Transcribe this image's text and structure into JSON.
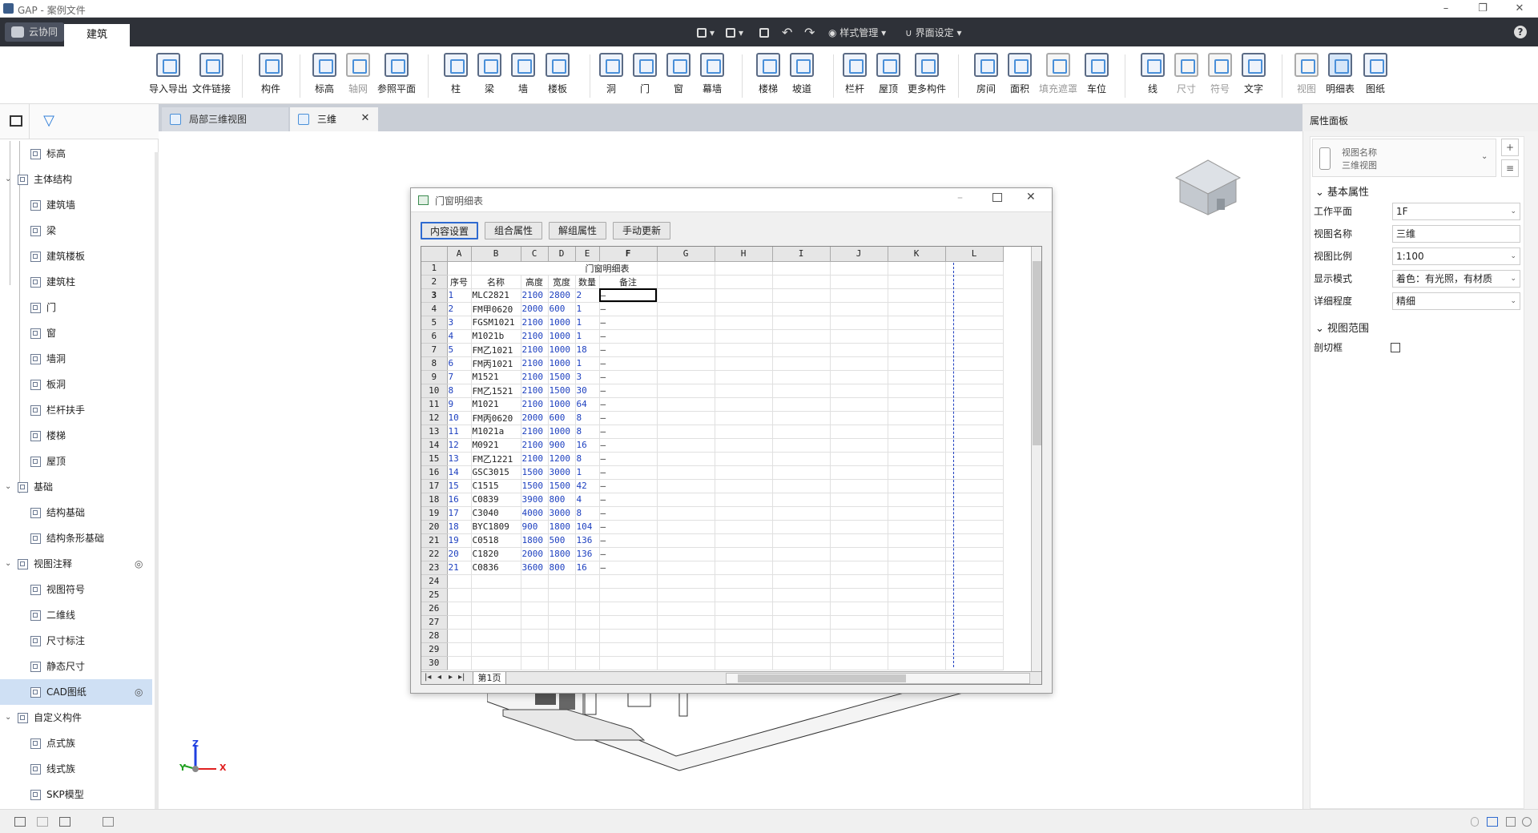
{
  "window": {
    "title": "GAP - 案例文件",
    "minimize": "–",
    "restore": "❐",
    "close": "✕"
  },
  "topbar": {
    "cloud_label": "云协同",
    "active_tab": "建筑",
    "style_mgmt": "样式管理",
    "ui_settings": "界面设定",
    "help": "?"
  },
  "ribbon": {
    "import_export": "导入导出",
    "file_link": "文件链接",
    "component": "构件",
    "elevation": "标高",
    "axis_grid": "轴网",
    "ref_plane": "参照平面",
    "column": "柱",
    "beam": "梁",
    "wall": "墙",
    "slab": "楼板",
    "opening": "洞",
    "door": "门",
    "window": "窗",
    "curtain_wall": "幕墙",
    "stairs": "楼梯",
    "ramp": "坡道",
    "railing": "栏杆",
    "roof": "屋顶",
    "more_components": "更多构件",
    "room": "房间",
    "area": "面积",
    "fill_mask": "填充遮罩",
    "parking": "车位",
    "line": "线",
    "dimension": "尺寸",
    "symbol": "符号",
    "text": "文字",
    "view": "视图",
    "schedule": "明细表",
    "drawing": "图纸"
  },
  "tree": {
    "items": [
      {
        "label": "标高",
        "level": 1,
        "exp": ""
      },
      {
        "label": "主体结构",
        "level": 0,
        "exp": "⌄"
      },
      {
        "label": "建筑墙",
        "level": 1,
        "exp": ""
      },
      {
        "label": "梁",
        "level": 1,
        "exp": ""
      },
      {
        "label": "建筑楼板",
        "level": 1,
        "exp": ""
      },
      {
        "label": "建筑柱",
        "level": 1,
        "exp": ""
      },
      {
        "label": "门",
        "level": 1,
        "exp": ""
      },
      {
        "label": "窗",
        "level": 1,
        "exp": ""
      },
      {
        "label": "墙洞",
        "level": 1,
        "exp": ""
      },
      {
        "label": "板洞",
        "level": 1,
        "exp": ""
      },
      {
        "label": "栏杆扶手",
        "level": 1,
        "exp": ""
      },
      {
        "label": "楼梯",
        "level": 1,
        "exp": ""
      },
      {
        "label": "屋顶",
        "level": 1,
        "exp": ""
      },
      {
        "label": "基础",
        "level": 0,
        "exp": "⌄"
      },
      {
        "label": "结构基础",
        "level": 1,
        "exp": ""
      },
      {
        "label": "结构条形基础",
        "level": 1,
        "exp": ""
      },
      {
        "label": "视图注释",
        "level": 0,
        "exp": "⌄"
      },
      {
        "label": "视图符号",
        "level": 1,
        "exp": ""
      },
      {
        "label": "二维线",
        "level": 1,
        "exp": ""
      },
      {
        "label": "尺寸标注",
        "level": 1,
        "exp": ""
      },
      {
        "label": "静态尺寸",
        "level": 1,
        "exp": ""
      },
      {
        "label": "CAD图纸",
        "level": 1,
        "exp": ""
      },
      {
        "label": "自定义构件",
        "level": 0,
        "exp": "⌄"
      },
      {
        "label": "点式族",
        "level": 1,
        "exp": ""
      },
      {
        "label": "线式族",
        "level": 1,
        "exp": ""
      },
      {
        "label": "SKP模型",
        "level": 1,
        "exp": ""
      }
    ]
  },
  "doc_tabs": {
    "tab1": "局部三维视图",
    "tab2": "三维",
    "close": "✕"
  },
  "dialog": {
    "title": "门窗明细表",
    "btn_content": "内容设置",
    "btn_group": "组合属性",
    "btn_ungroup": "解组属性",
    "btn_update": "手动更新",
    "sheet_tab": "第1页",
    "columns": [
      "A",
      "B",
      "C",
      "D",
      "E",
      "F",
      "G",
      "H",
      "I",
      "J",
      "K",
      "L"
    ],
    "sheet_title": "门窗明细表",
    "headers": [
      "序号",
      "名称",
      "高度",
      "宽度",
      "数量",
      "备注"
    ],
    "rows": [
      [
        "1",
        "MLC2821",
        "2100",
        "2800",
        "2",
        "–"
      ],
      [
        "2",
        "FM甲0620",
        "2000",
        "600",
        "1",
        "–"
      ],
      [
        "3",
        "FGSM1021",
        "2100",
        "1000",
        "1",
        "–"
      ],
      [
        "4",
        "M1021b",
        "2100",
        "1000",
        "1",
        "–"
      ],
      [
        "5",
        "FM乙1021",
        "2100",
        "1000",
        "18",
        "–"
      ],
      [
        "6",
        "FM丙1021",
        "2100",
        "1000",
        "1",
        "–"
      ],
      [
        "7",
        "M1521",
        "2100",
        "1500",
        "3",
        "–"
      ],
      [
        "8",
        "FM乙1521",
        "2100",
        "1500",
        "30",
        "–"
      ],
      [
        "9",
        "M1021",
        "2100",
        "1000",
        "64",
        "–"
      ],
      [
        "10",
        "FM丙0620",
        "2000",
        "600",
        "8",
        "–"
      ],
      [
        "11",
        "M1021a",
        "2100",
        "1000",
        "8",
        "–"
      ],
      [
        "12",
        "M0921",
        "2100",
        "900",
        "16",
        "–"
      ],
      [
        "13",
        "FM乙1221",
        "2100",
        "1200",
        "8",
        "–"
      ],
      [
        "14",
        "GSC3015",
        "1500",
        "3000",
        "1",
        "–"
      ],
      [
        "15",
        "C1515",
        "1500",
        "1500",
        "42",
        "–"
      ],
      [
        "16",
        "C0839",
        "3900",
        "800",
        "4",
        "–"
      ],
      [
        "17",
        "C3040",
        "4000",
        "3000",
        "8",
        "–"
      ],
      [
        "18",
        "BYC1809",
        "900",
        "1800",
        "104",
        "–"
      ],
      [
        "19",
        "C0518",
        "1800",
        "500",
        "136",
        "–"
      ],
      [
        "20",
        "C1820",
        "2000",
        "1800",
        "136",
        "–"
      ],
      [
        "21",
        "C0836",
        "3600",
        "800",
        "16",
        "–"
      ]
    ],
    "row_numbers": [
      "1",
      "2",
      "3",
      "4",
      "5",
      "6",
      "7",
      "8",
      "9",
      "10",
      "11",
      "12",
      "13",
      "14",
      "15",
      "16",
      "17",
      "18",
      "19",
      "20",
      "21",
      "22",
      "23",
      "24",
      "25",
      "26",
      "27",
      "28",
      "29",
      "30"
    ]
  },
  "properties": {
    "panel_title": "属性面板",
    "view_name_label": "视图名称",
    "view_type": "三维视图",
    "section_basic": "基本属性",
    "work_plane_label": "工作平面",
    "work_plane": "1F",
    "view_name_row_label": "视图名称",
    "view_name": "三维",
    "scale_label": "视图比例",
    "scale": "1:100",
    "display_mode_label": "显示模式",
    "display_mode": "着色：有光照，有材质",
    "detail_label": "详细程度",
    "detail": "精细",
    "section_range": "视图范围",
    "section_box_label": "剖切框"
  },
  "axes": {
    "x": "X",
    "y": "Y",
    "z": "Z"
  },
  "colors": {
    "accent": "#4a90d9",
    "dark_bar": "#2e3138",
    "blue_text": "#1c3fbf"
  }
}
